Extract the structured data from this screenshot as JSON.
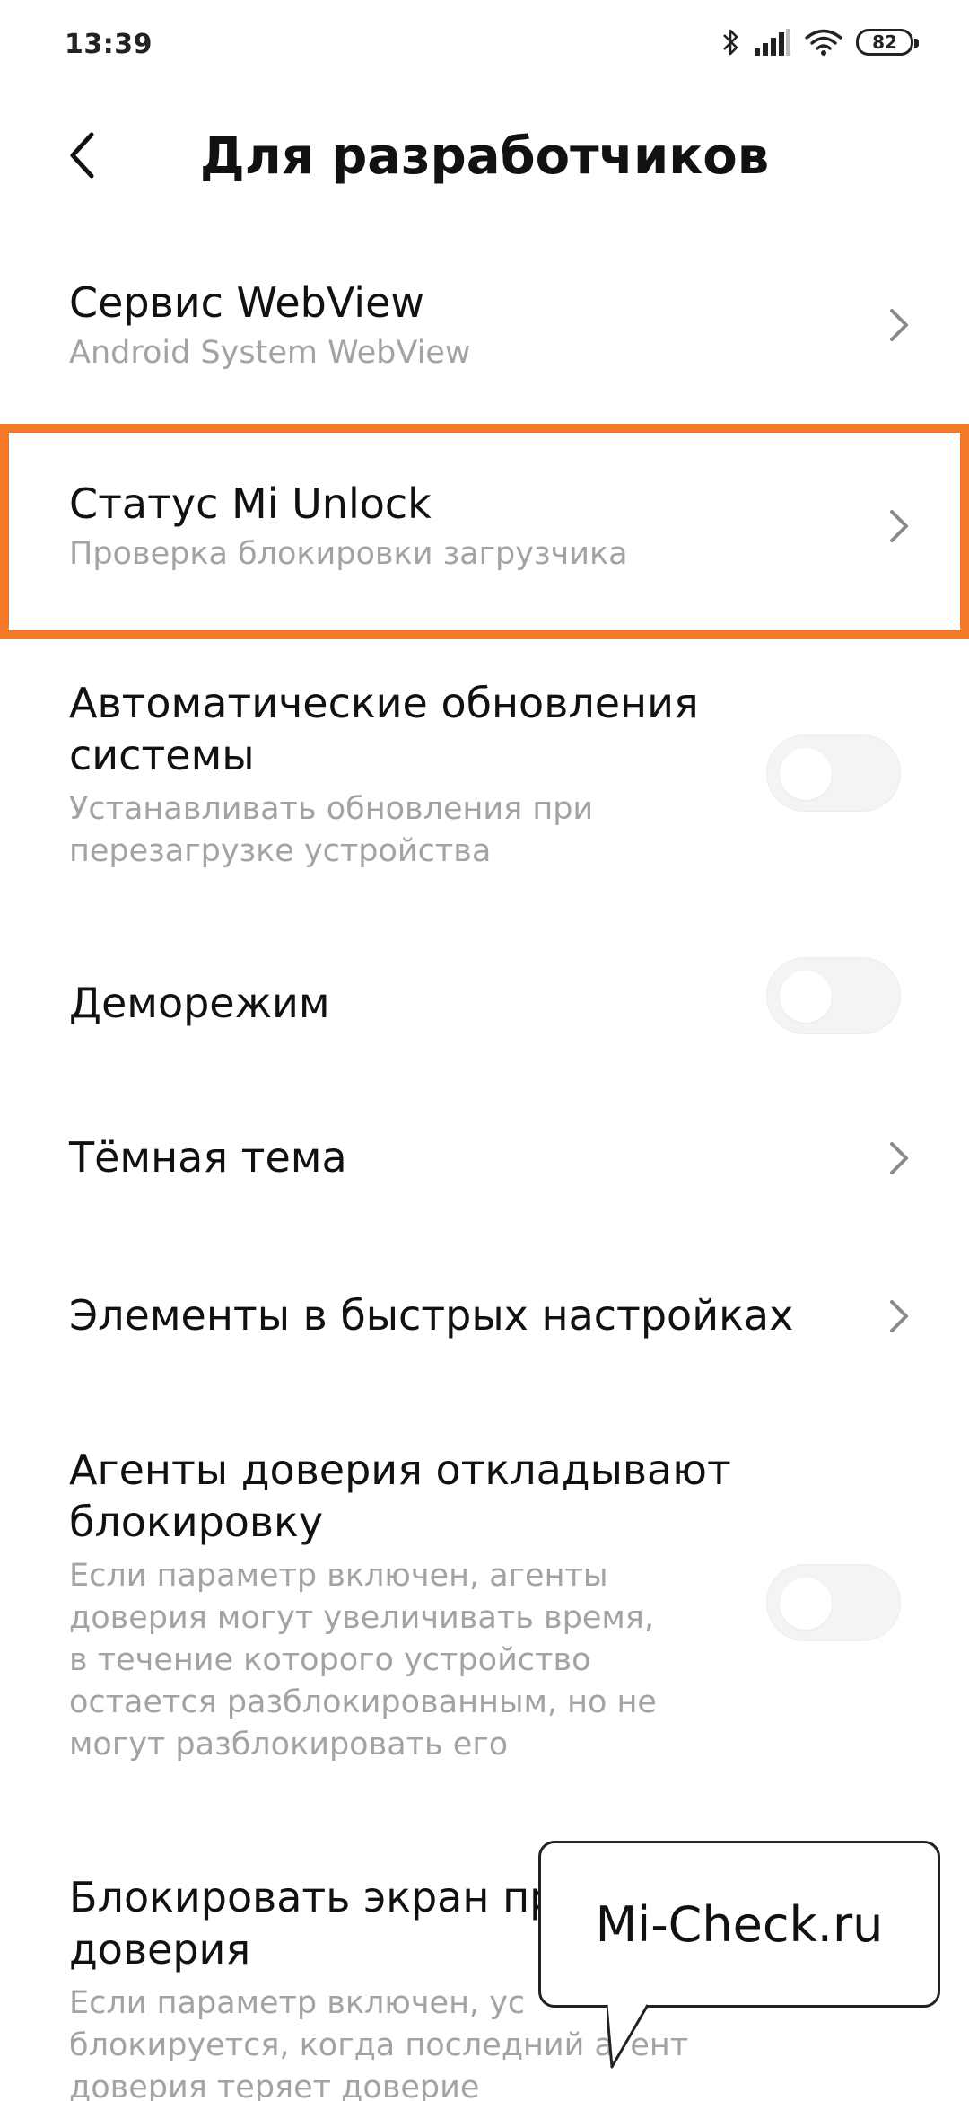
{
  "status_bar": {
    "time": "13:39",
    "battery": "82",
    "icons": [
      "bluetooth-icon",
      "signal-icon",
      "wifi-icon",
      "battery-icon"
    ]
  },
  "header": {
    "title": "Для разработчиков",
    "back_icon": "chevron-left-icon"
  },
  "rows": [
    {
      "id": "webview",
      "title": "Сервис WebView",
      "subtitle": "Android System WebView",
      "control": "chevron"
    },
    {
      "id": "mi-unlock",
      "title": "Статус Mi Unlock",
      "subtitle": "Проверка блокировки загрузчика",
      "control": "chevron",
      "highlighted": true
    },
    {
      "id": "auto-updates",
      "title_lines": [
        "Автоматические обновления",
        "системы"
      ],
      "subtitle_lines": [
        "Устанавливать обновления при",
        "перезагрузке устройства"
      ],
      "control": "toggle",
      "value": false
    },
    {
      "id": "demo-mode",
      "title": "Деморежим",
      "control": "toggle",
      "value": false
    },
    {
      "id": "dark-theme",
      "title": "Тёмная тема",
      "control": "chevron"
    },
    {
      "id": "quick-settings",
      "title": "Элементы в быстрых настройках",
      "control": "chevron"
    },
    {
      "id": "trust-agents",
      "title_lines": [
        "Агенты доверия откладывают",
        "блокировку"
      ],
      "subtitle_lines": [
        "Если параметр включен, агенты",
        "доверия могут увеличивать время,",
        "в течение которого устройство",
        "остается разблокированным, но не",
        "могут разблокировать его"
      ],
      "control": "toggle",
      "value": false
    },
    {
      "id": "lock-screen-trust",
      "title_lines": [
        "Блокировать экран пр",
        "доверия"
      ],
      "subtitle_lines": [
        "Если параметр включен, ус",
        "блокируется, когда последний агент",
        "доверия теряет доверие"
      ],
      "control": "none"
    }
  ],
  "watermark": {
    "text": "Mi-Check.ru"
  },
  "colors": {
    "highlight": "#f47a2a",
    "subtitle": "#a3a3a3",
    "title": "#111111",
    "toggle_track": "#f4f4f4"
  }
}
